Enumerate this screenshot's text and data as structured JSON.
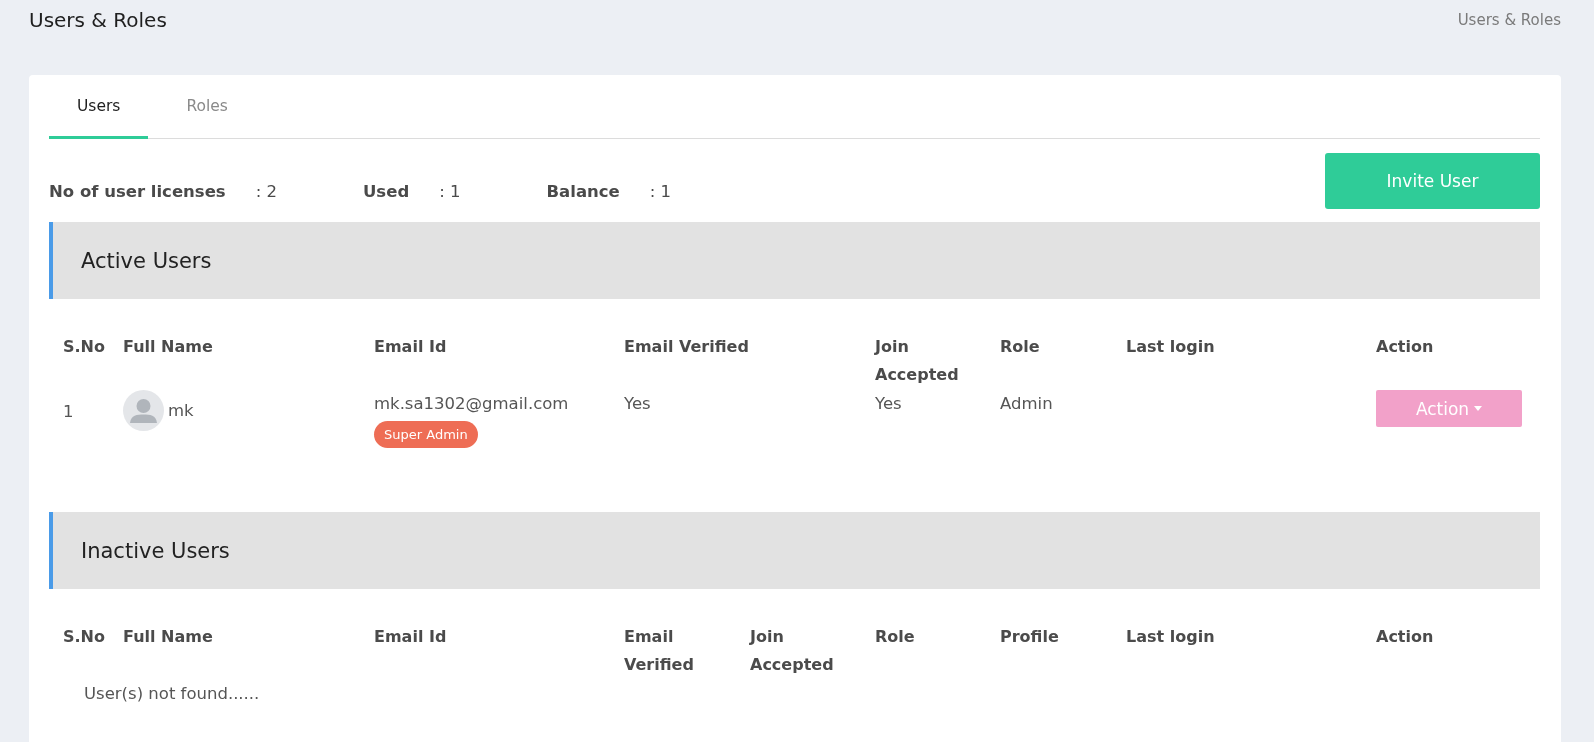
{
  "page": {
    "title": "Users & Roles",
    "breadcrumb": "Users & Roles"
  },
  "tabs": [
    {
      "label": "Users",
      "selected": true
    },
    {
      "label": "Roles",
      "selected": false
    }
  ],
  "licenses": [
    {
      "label": "No of user licenses",
      "value": ": 2"
    },
    {
      "label": "Used",
      "value": ": 1"
    },
    {
      "label": "Balance",
      "value": ": 1"
    }
  ],
  "invite_button": "Invite User",
  "active_users": {
    "title": "Active Users",
    "columns": [
      "S.No",
      "Full Name",
      "Email Id",
      "Email Verified",
      "Join Accepted",
      "Role",
      "Last login",
      "Action"
    ],
    "rows": [
      {
        "sno": "1",
        "full_name": "mk",
        "email": "mk.sa1302@gmail.com",
        "badge": "Super Admin",
        "email_verified": "Yes",
        "join_accepted": "Yes",
        "role": "Admin",
        "action": "Action"
      }
    ]
  },
  "inactive_users": {
    "title": "Inactive Users",
    "columns": [
      "S.No",
      "Full Name",
      "Email Id",
      "Email Verified",
      "Join Accepted",
      "Role",
      "Profile",
      "Last login",
      "Action"
    ],
    "empty_message": "User(s) not found......"
  }
}
